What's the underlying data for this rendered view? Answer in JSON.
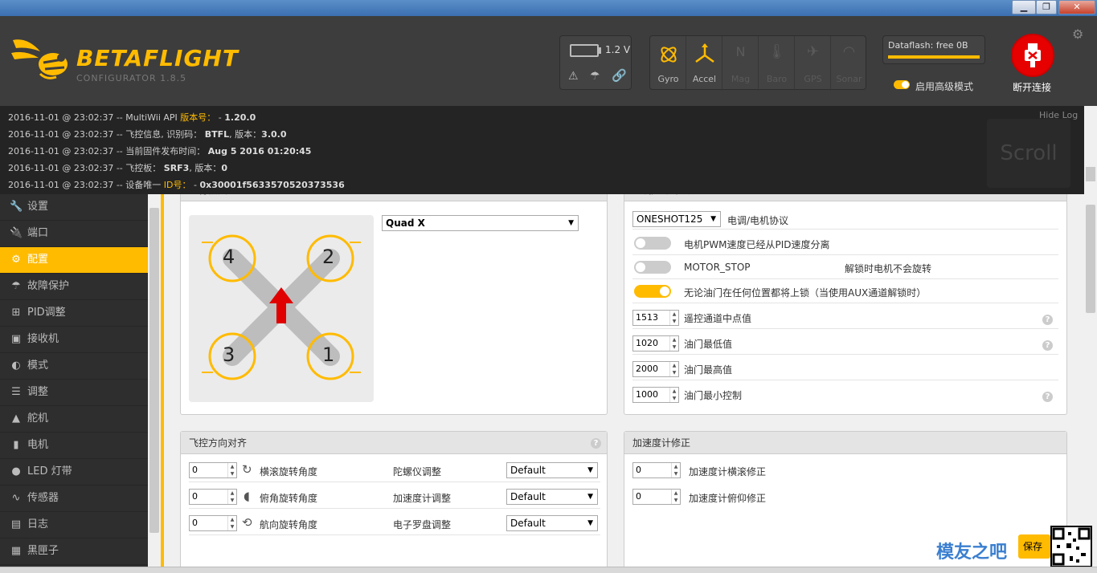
{
  "window": {
    "minimize": "▁",
    "maximize": "❐",
    "close": "✕"
  },
  "brand": {
    "name": "BETAFLIGHT",
    "sub": "CONFIGURATOR  1.8.5"
  },
  "battery": {
    "voltage": "1.2 V"
  },
  "sensors": [
    {
      "name": "Gyro",
      "icon": "gyro-icon",
      "active": true
    },
    {
      "name": "Accel",
      "icon": "accel-icon",
      "active": true
    },
    {
      "name": "Mag",
      "icon": "mag-icon",
      "active": false
    },
    {
      "name": "Baro",
      "icon": "baro-icon",
      "active": false
    },
    {
      "name": "GPS",
      "icon": "gps-icon",
      "active": false
    },
    {
      "name": "Sonar",
      "icon": "sonar-icon",
      "active": false
    }
  ],
  "dataflash": {
    "label": "Dataflash: free 0B"
  },
  "expert_mode": {
    "label": "启用高级模式"
  },
  "disconnect": {
    "label": "断开连接"
  },
  "log": {
    "hide": "Hide Log",
    "scroll": "Scroll",
    "lines": [
      {
        "ts": "2016-11-01 @ 23:02:37 -- MultiWii API ",
        "hl": "版本号：",
        "rest": " - ",
        "val": "1.20.0"
      },
      {
        "ts": "2016-11-01 @ 23:02:37 -- 飞控信息, 识别码：",
        "hl": "",
        "rest": "  ",
        "val": "BTFL",
        "extra": ", 版本：",
        "val2": "3.0.0"
      },
      {
        "ts": "2016-11-01 @ 23:02:37 -- 当前固件发布时间：",
        "hl": "",
        "rest": "  ",
        "val": "Aug 5 2016 01:20:45"
      },
      {
        "ts": "2016-11-01 @ 23:02:37 -- 飞控板：",
        "hl": "",
        "rest": "  ",
        "val": "SRF3",
        "extra": ", 版本：",
        "val2": "0"
      },
      {
        "ts": "2016-11-01 @ 23:02:37 -- 设备唯一 ",
        "hl": "ID号：",
        "rest": " - ",
        "val": "0x30001f5633570520373536"
      }
    ]
  },
  "nav": [
    {
      "label": "设置",
      "icon": "wrench-icon",
      "glyph": "🔧",
      "active": false
    },
    {
      "label": "端口",
      "icon": "plug-icon",
      "glyph": "🔌",
      "active": false
    },
    {
      "label": "配置",
      "icon": "gear-icon",
      "glyph": "⚙",
      "active": true
    },
    {
      "label": "故障保护",
      "icon": "parachute-icon",
      "glyph": "☂",
      "active": false
    },
    {
      "label": "PID调整",
      "icon": "sitemap-icon",
      "glyph": "⊞",
      "active": false
    },
    {
      "label": "接收机",
      "icon": "receiver-icon",
      "glyph": "▣",
      "active": false
    },
    {
      "label": "模式",
      "icon": "toggle-icon",
      "glyph": "◐",
      "active": false
    },
    {
      "label": "调整",
      "icon": "sliders-icon",
      "glyph": "☰",
      "active": false
    },
    {
      "label": "舵机",
      "icon": "servo-icon",
      "glyph": "▲",
      "active": false
    },
    {
      "label": "电机",
      "icon": "motor-icon",
      "glyph": "▮",
      "active": false
    },
    {
      "label": "LED 灯带",
      "icon": "led-icon",
      "glyph": "●",
      "active": false
    },
    {
      "label": "传感器",
      "icon": "pulse-icon",
      "glyph": "∿",
      "active": false
    },
    {
      "label": "日志",
      "icon": "keyboard-icon",
      "glyph": "▤",
      "active": false
    },
    {
      "label": "黑匣子",
      "icon": "blackbox-icon",
      "glyph": "▦",
      "active": false
    }
  ],
  "mixer": {
    "title": "飞行器类型",
    "type": "Quad X",
    "motors": [
      "4",
      "2",
      "3",
      "1"
    ]
  },
  "esc": {
    "title": "电调/电机参数",
    "protocol": "ONESHOT125",
    "protocol_label": "电调/电机协议",
    "pwm_label": "电机PWM速度已经从PID速度分离",
    "motor_stop_label": "MOTOR_STOP",
    "motor_stop_desc": "解锁时电机不会旋转",
    "arm_label": "无论油门在任何位置都将上锁（当使用AUX通道解锁时）",
    "midrc": "1513",
    "midrc_label": "遥控通道中点值",
    "minthrottle": "1020",
    "minthrottle_label": "油门最低值",
    "maxthrottle": "2000",
    "maxthrottle_label": "油门最高值",
    "mincommand": "1000",
    "mincommand_label": "油门最小控制"
  },
  "align": {
    "title": "飞控方向对齐",
    "rows": [
      {
        "value": "0",
        "label": "横滚旋转角度",
        "sensor": "陀螺仪调整",
        "select": "Default"
      },
      {
        "value": "0",
        "label": "俯角旋转角度",
        "sensor": "加速度计调整",
        "select": "Default"
      },
      {
        "value": "0",
        "label": "航向旋转角度",
        "sensor": "电子罗盘调整",
        "select": "Default"
      }
    ]
  },
  "acc": {
    "title": "加速度计修正",
    "roll": "0",
    "roll_label": "加速度计横滚修正",
    "pitch": "0",
    "pitch_label": "加速度计俯仰修正"
  },
  "help": "?",
  "save": "保存并",
  "watermark": "模友之吧"
}
